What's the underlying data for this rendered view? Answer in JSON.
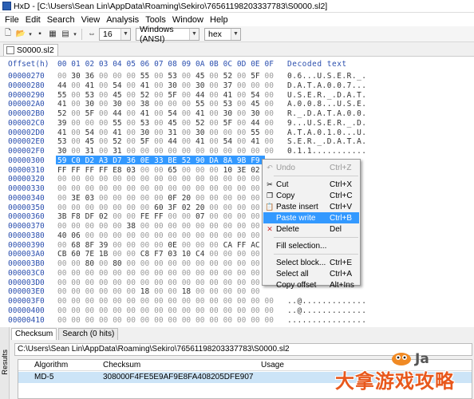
{
  "titlebar": {
    "title": "HxD - [C:\\Users\\Sean Lin\\AppData\\Roaming\\Sekiro\\76561198203337783\\S0000.sl2]"
  },
  "menu": [
    "File",
    "Edit",
    "Search",
    "View",
    "Analysis",
    "Tools",
    "Window",
    "Help"
  ],
  "toolbar": {
    "bytes_per_row": "16",
    "charset": "Windows (ANSI)",
    "display_mode": "hex"
  },
  "document_tab": {
    "label": "S0000.sl2"
  },
  "hex_view": {
    "offset_header": "Offset(h)",
    "column_headers": [
      "00",
      "01",
      "02",
      "03",
      "04",
      "05",
      "06",
      "07",
      "08",
      "09",
      "0A",
      "0B",
      "0C",
      "0D",
      "0E",
      "0F"
    ],
    "decoded_header": "Decoded text",
    "rows": [
      {
        "offset": "00000270",
        "bytes": [
          "00",
          "30",
          "36",
          "00",
          "00",
          "00",
          "55",
          "00",
          "53",
          "00",
          "45",
          "00",
          "52",
          "00",
          "5F",
          "00"
        ],
        "text": "0.6...U.S.E.R._."
      },
      {
        "offset": "00000280",
        "bytes": [
          "44",
          "00",
          "41",
          "00",
          "54",
          "00",
          "41",
          "00",
          "30",
          "00",
          "30",
          "00",
          "37",
          "00",
          "00",
          "00"
        ],
        "text": "D.A.T.A.0.0.7..."
      },
      {
        "offset": "00000290",
        "bytes": [
          "55",
          "00",
          "53",
          "00",
          "45",
          "00",
          "52",
          "00",
          "5F",
          "00",
          "44",
          "00",
          "41",
          "00",
          "54",
          "00"
        ],
        "text": "U.S.E.R._.D.A.T."
      },
      {
        "offset": "000002A0",
        "bytes": [
          "41",
          "00",
          "30",
          "00",
          "30",
          "00",
          "38",
          "00",
          "00",
          "00",
          "55",
          "00",
          "53",
          "00",
          "45",
          "00"
        ],
        "text": "A.0.0.8...U.S.E."
      },
      {
        "offset": "000002B0",
        "bytes": [
          "52",
          "00",
          "5F",
          "00",
          "44",
          "00",
          "41",
          "00",
          "54",
          "00",
          "41",
          "00",
          "30",
          "00",
          "30",
          "00"
        ],
        "text": "R._.D.A.T.A.0.0."
      },
      {
        "offset": "000002C0",
        "bytes": [
          "39",
          "00",
          "00",
          "00",
          "55",
          "00",
          "53",
          "00",
          "45",
          "00",
          "52",
          "00",
          "5F",
          "00",
          "44",
          "00"
        ],
        "text": "9...U.S.E.R._.D."
      },
      {
        "offset": "000002D0",
        "bytes": [
          "41",
          "00",
          "54",
          "00",
          "41",
          "00",
          "30",
          "00",
          "31",
          "00",
          "30",
          "00",
          "00",
          "00",
          "55",
          "00"
        ],
        "text": "A.T.A.0.1.0...U."
      },
      {
        "offset": "000002E0",
        "bytes": [
          "53",
          "00",
          "45",
          "00",
          "52",
          "00",
          "5F",
          "00",
          "44",
          "00",
          "41",
          "00",
          "54",
          "00",
          "41",
          "00"
        ],
        "text": "S.E.R._.D.A.T.A."
      },
      {
        "offset": "000002F0",
        "bytes": [
          "30",
          "00",
          "31",
          "00",
          "31",
          "00",
          "00",
          "00",
          "00",
          "00",
          "00",
          "00",
          "00",
          "00",
          "00",
          "00"
        ],
        "text": "0.1.1..........."
      },
      {
        "offset": "00000300",
        "bytes": [
          "59",
          "C0",
          "D2",
          "A3",
          "D7",
          "36",
          "0E",
          "33",
          "BE",
          "52",
          "90",
          "DA",
          "8A",
          "9B",
          "F9",
          ""
        ],
        "text": ""
      },
      {
        "offset": "00000310",
        "bytes": [
          "FF",
          "FF",
          "FF",
          "FF",
          "E8",
          "03",
          "00",
          "00",
          "65",
          "00",
          "00",
          "00",
          "10",
          "3E",
          "02",
          ""
        ],
        "text": ""
      },
      {
        "offset": "00000320",
        "bytes": [
          "00",
          "00",
          "00",
          "00",
          "00",
          "00",
          "00",
          "00",
          "00",
          "00",
          "00",
          "00",
          "00",
          "00",
          "00",
          ""
        ],
        "text": ""
      },
      {
        "offset": "00000330",
        "bytes": [
          "00",
          "00",
          "00",
          "00",
          "00",
          "00",
          "00",
          "00",
          "00",
          "00",
          "00",
          "00",
          "00",
          "00",
          "00",
          ""
        ],
        "text": ""
      },
      {
        "offset": "00000340",
        "bytes": [
          "00",
          "3E",
          "03",
          "00",
          "00",
          "00",
          "00",
          "00",
          "0F",
          "20",
          "00",
          "00",
          "00",
          "00",
          "00",
          ""
        ],
        "text": ""
      },
      {
        "offset": "00000350",
        "bytes": [
          "00",
          "00",
          "00",
          "00",
          "00",
          "00",
          "00",
          "60",
          "3F",
          "02",
          "20",
          "00",
          "00",
          "00",
          "00",
          ""
        ],
        "text": ""
      },
      {
        "offset": "00000360",
        "bytes": [
          "3B",
          "F8",
          "DF",
          "02",
          "00",
          "00",
          "FE",
          "FF",
          "00",
          "00",
          "07",
          "00",
          "00",
          "00",
          "00",
          ""
        ],
        "text": ""
      },
      {
        "offset": "00000370",
        "bytes": [
          "00",
          "00",
          "00",
          "00",
          "00",
          "38",
          "00",
          "00",
          "00",
          "00",
          "00",
          "00",
          "00",
          "00",
          "00",
          ""
        ],
        "text": ""
      },
      {
        "offset": "00000380",
        "bytes": [
          "40",
          "06",
          "00",
          "00",
          "00",
          "00",
          "00",
          "00",
          "00",
          "00",
          "00",
          "00",
          "00",
          "00",
          "00",
          ""
        ],
        "text": ""
      },
      {
        "offset": "00000390",
        "bytes": [
          "00",
          "68",
          "8F",
          "39",
          "00",
          "00",
          "00",
          "00",
          "0E",
          "00",
          "00",
          "00",
          "CA",
          "FF",
          "AC",
          ""
        ],
        "text": ""
      },
      {
        "offset": "000003A0",
        "bytes": [
          "CB",
          "60",
          "7E",
          "1B",
          "00",
          "00",
          "C8",
          "F7",
          "03",
          "10",
          "C4",
          "00",
          "00",
          "00",
          "00",
          ""
        ],
        "text": ""
      },
      {
        "offset": "000003B0",
        "bytes": [
          "00",
          "00",
          "80",
          "00",
          "80",
          "00",
          "00",
          "00",
          "00",
          "00",
          "00",
          "00",
          "00",
          "00",
          "00",
          ""
        ],
        "text": ""
      },
      {
        "offset": "000003C0",
        "bytes": [
          "00",
          "00",
          "00",
          "00",
          "00",
          "00",
          "00",
          "00",
          "00",
          "00",
          "00",
          "00",
          "00",
          "00",
          "00",
          ""
        ],
        "text": ""
      },
      {
        "offset": "000003D0",
        "bytes": [
          "00",
          "00",
          "00",
          "00",
          "00",
          "00",
          "00",
          "00",
          "00",
          "00",
          "00",
          "00",
          "00",
          "00",
          "00",
          ""
        ],
        "text": ""
      },
      {
        "offset": "000003E0",
        "bytes": [
          "00",
          "00",
          "00",
          "00",
          "00",
          "00",
          "18",
          "00",
          "00",
          "18",
          "00",
          "00",
          "00",
          "00",
          "00",
          ""
        ],
        "text": ""
      },
      {
        "offset": "000003F0",
        "bytes": [
          "00",
          "00",
          "00",
          "00",
          "00",
          "00",
          "00",
          "00",
          "00",
          "00",
          "00",
          "00",
          "00",
          "00",
          "00",
          "00"
        ],
        "text": "..@............."
      },
      {
        "offset": "00000400",
        "bytes": [
          "00",
          "00",
          "00",
          "00",
          "00",
          "00",
          "00",
          "00",
          "00",
          "00",
          "00",
          "00",
          "00",
          "00",
          "00",
          "00"
        ],
        "text": "..@............."
      },
      {
        "offset": "00000410",
        "bytes": [
          "00",
          "00",
          "00",
          "00",
          "00",
          "00",
          "00",
          "00",
          "00",
          "00",
          "00",
          "00",
          "00",
          "00",
          "00",
          "00"
        ],
        "text": "................"
      }
    ]
  },
  "context_menu": [
    {
      "label": "Undo",
      "shortcut": "Ctrl+Z",
      "disabled": true,
      "icon": "undo-icon"
    },
    {
      "sep": true
    },
    {
      "label": "Cut",
      "shortcut": "Ctrl+X",
      "icon": "cut-icon"
    },
    {
      "label": "Copy",
      "shortcut": "Ctrl+C",
      "icon": "copy-icon"
    },
    {
      "label": "Paste insert",
      "shortcut": "Ctrl+V",
      "icon": "paste-icon"
    },
    {
      "label": "Paste write",
      "shortcut": "Ctrl+B",
      "hover": true
    },
    {
      "label": "Delete",
      "shortcut": "Del",
      "icon": "delete-icon"
    },
    {
      "sep": true
    },
    {
      "label": "Fill selection..."
    },
    {
      "sep": true
    },
    {
      "label": "Select block...",
      "shortcut": "Ctrl+E"
    },
    {
      "label": "Select all",
      "shortcut": "Ctrl+A"
    },
    {
      "label": "Copy offset",
      "shortcut": "Alt+Ins"
    }
  ],
  "results": {
    "label": "Results",
    "tabs": [
      "Checksum",
      "Search (0 hits)"
    ],
    "path": "C:\\Users\\Sean Lin\\AppData\\Roaming\\Sekiro\\76561198203337783\\S0000.sl2",
    "columns": [
      "Algorithm",
      "Checksum",
      "Usage"
    ],
    "row": {
      "algorithm": "MD-5",
      "checksum": "308000F4FE5E9AF9E8FA408205DFE907",
      "usage": ""
    }
  },
  "watermark": {
    "text": "大拿游戏攻略",
    "url": "Ja"
  }
}
